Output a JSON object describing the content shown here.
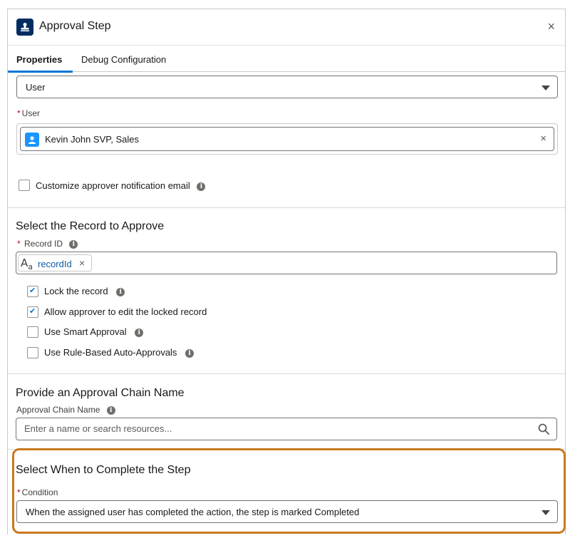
{
  "header": {
    "title": "Approval Step",
    "close_label": "×"
  },
  "tabs": [
    {
      "label": "Properties",
      "active": true
    },
    {
      "label": "Debug Configuration",
      "active": false
    }
  ],
  "approver_type": {
    "value": "User"
  },
  "user_field": {
    "label": "User",
    "required_mark": "*",
    "selected_value": "Kevin John SVP, Sales",
    "remove_label": "×"
  },
  "customize_email": {
    "label": "Customize approver notification email",
    "checked": false
  },
  "record_section": {
    "title": "Select the Record to Approve",
    "record_id_label": "Record ID",
    "required_mark": "*",
    "token_type_icon": "text-type-icon",
    "token_value": "recordId",
    "token_remove_label": "×",
    "options": [
      {
        "label": "Lock the record",
        "checked": true,
        "info": true
      },
      {
        "label": "Allow approver to edit the locked record",
        "checked": true,
        "info": false
      },
      {
        "label": "Use Smart Approval",
        "checked": false,
        "info": true
      },
      {
        "label": "Use Rule-Based Auto-Approvals",
        "checked": false,
        "info": true
      }
    ]
  },
  "chain_section": {
    "title": "Provide an Approval Chain Name",
    "field_label": "Approval Chain Name",
    "placeholder": "Enter a name or search resources..."
  },
  "complete_section": {
    "title": "Select When to Complete the Step",
    "condition_label": "Condition",
    "required_mark": "*",
    "condition_value": "When the assigned user has completed the action, the step is marked Completed"
  },
  "colors": {
    "highlight_border": "#c9791f",
    "brand_blue": "#0176d3",
    "required_red": "#ba0517",
    "header_icon_bg": "#032d60"
  }
}
